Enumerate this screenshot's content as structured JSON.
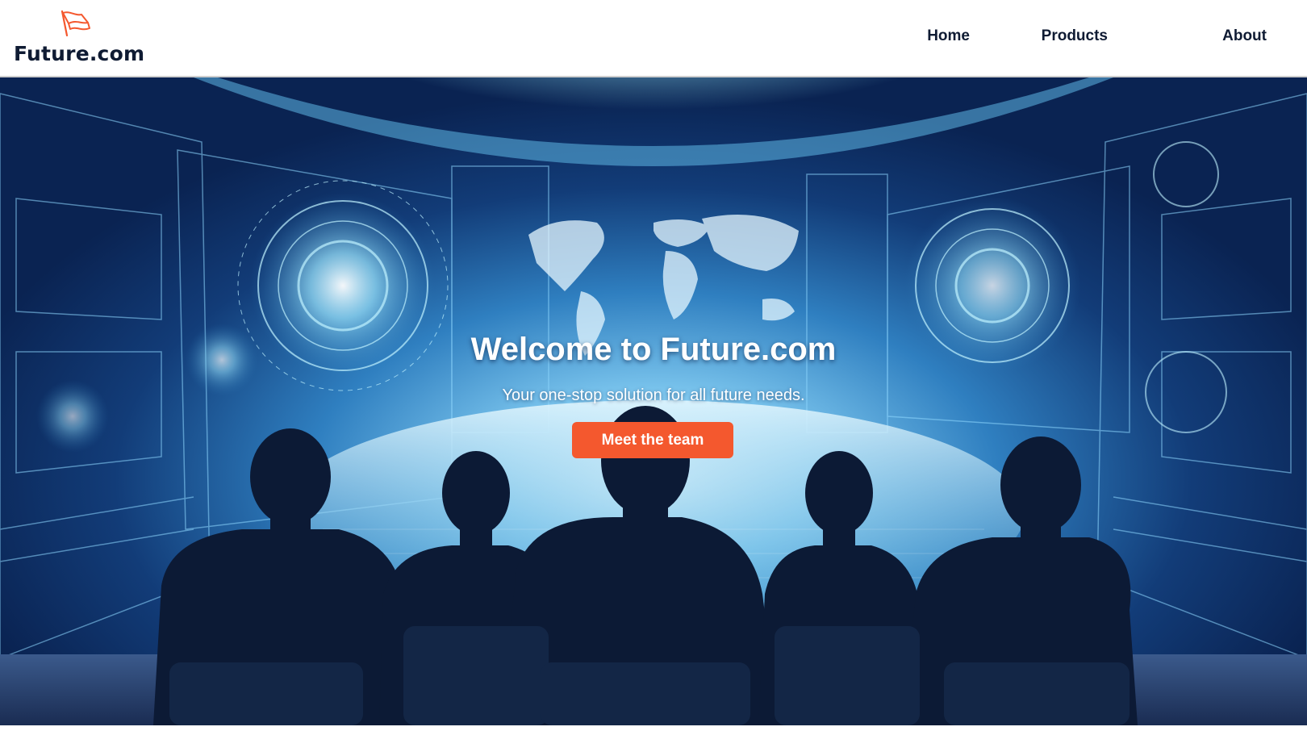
{
  "brand": {
    "name": "Future.com",
    "logo_icon": "flag-icon",
    "accent_color": "#f4582e",
    "text_color": "#0f1b33"
  },
  "nav": {
    "items": [
      {
        "label": "Home"
      },
      {
        "label": "Products"
      },
      {
        "label": "About"
      }
    ]
  },
  "hero": {
    "title": "Welcome to Future.com",
    "subtitle": "Your one-stop solution for all future needs.",
    "cta_label": "Meet the team",
    "cta_color": "#f4582e"
  }
}
